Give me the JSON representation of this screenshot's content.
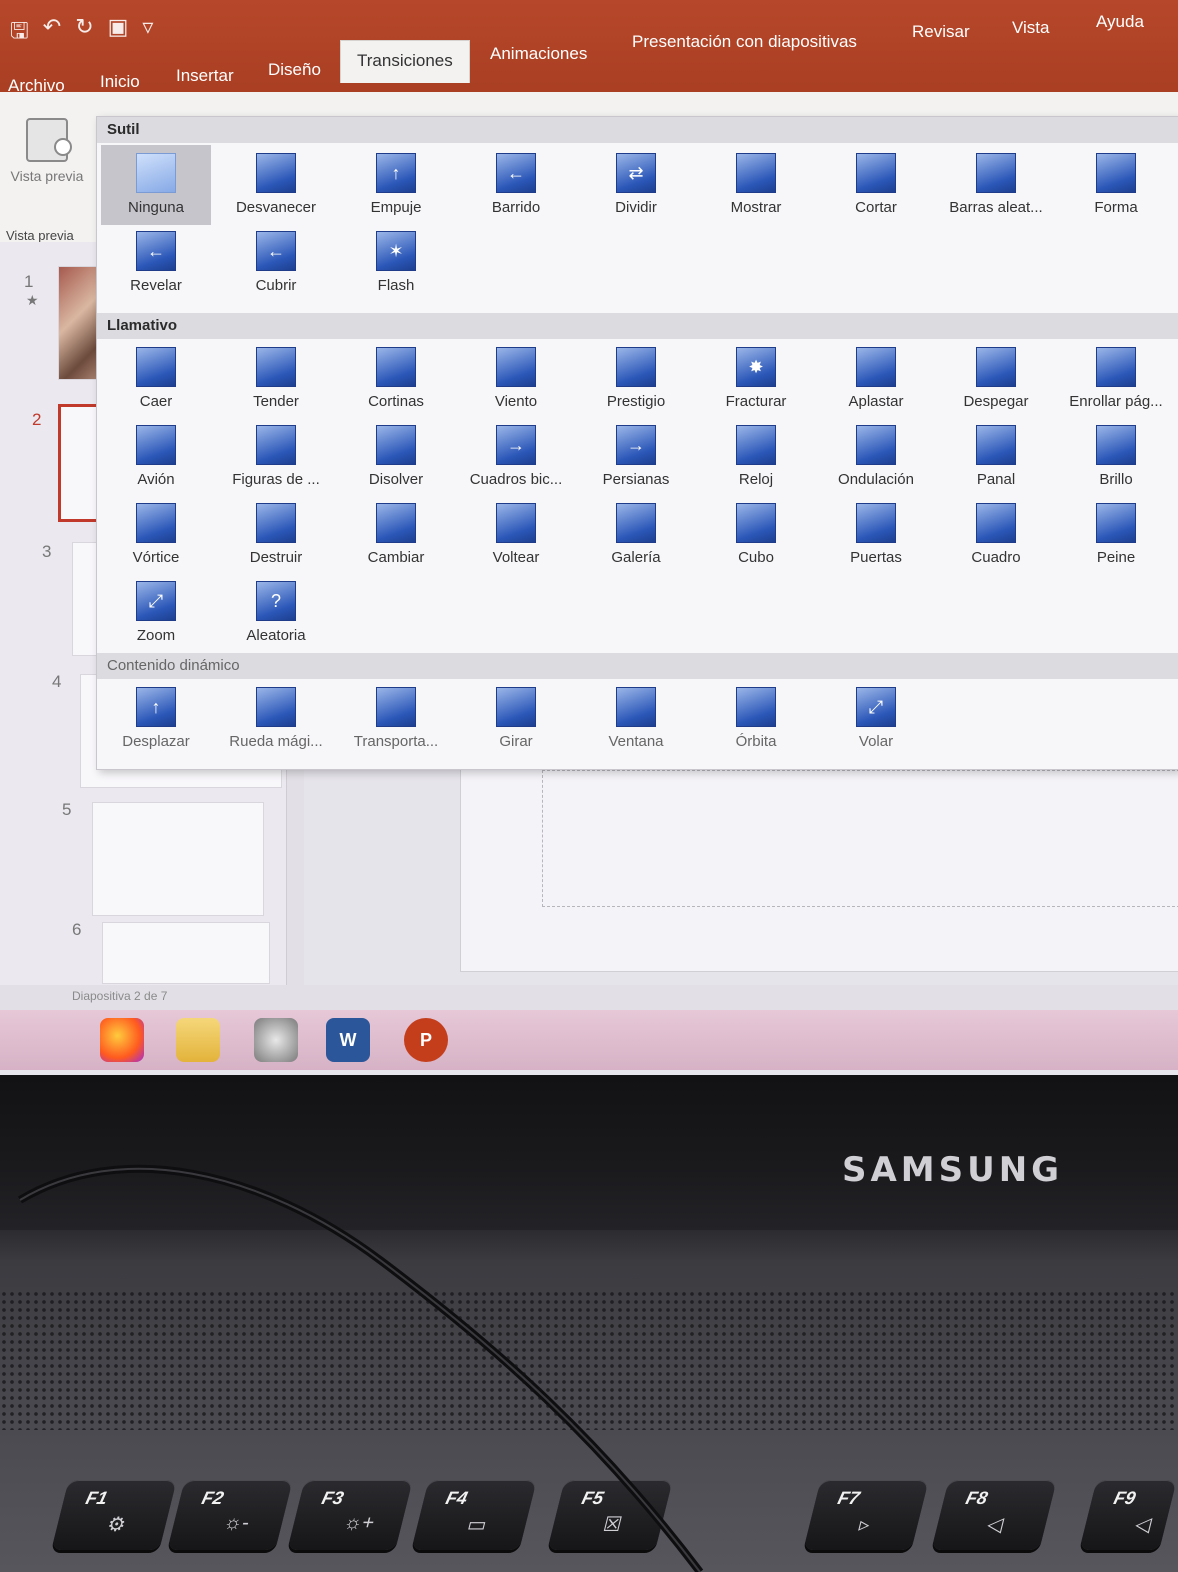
{
  "ribbon": {
    "tabs": [
      "Archivo",
      "Inicio",
      "Insertar",
      "Diseño",
      "Transiciones",
      "Animaciones",
      "Presentación con diapositivas",
      "Revisar",
      "Vista",
      "Ayuda"
    ],
    "active_tab": "Transiciones",
    "preview": {
      "button_label": "Vista previa",
      "group_label": "Vista previa"
    }
  },
  "gallery": {
    "sections": [
      {
        "title": "Sutil",
        "items": [
          "Ninguna",
          "Desvanecer",
          "Empuje",
          "Barrido",
          "Dividir",
          "Mostrar",
          "Cortar",
          "Barras aleat...",
          "Forma",
          "Revelar",
          "Cubrir",
          "Flash"
        ]
      },
      {
        "title": "Llamativo",
        "items": [
          "Caer",
          "Tender",
          "Cortinas",
          "Viento",
          "Prestigio",
          "Fracturar",
          "Aplastar",
          "Despegar",
          "Enrollar pág...",
          "Avión",
          "Figuras de ...",
          "Disolver",
          "Cuadros bic...",
          "Persianas",
          "Reloj",
          "Ondulación",
          "Panal",
          "Brillo",
          "Vórtice",
          "Destruir",
          "Cambiar",
          "Voltear",
          "Galería",
          "Cubo",
          "Puertas",
          "Cuadro",
          "Peine",
          "Zoom",
          "Aleatoria"
        ]
      },
      {
        "title": "Contenido dinámico",
        "items": [
          "Desplazar",
          "Rueda mági...",
          "Transporta...",
          "Girar",
          "Ventana",
          "Órbita",
          "Volar"
        ]
      }
    ],
    "selected": "Ninguna"
  },
  "slides": {
    "numbers": [
      "1",
      "2",
      "3",
      "4",
      "5",
      "6"
    ],
    "selected": "2"
  },
  "status": {
    "text": "Diapositiva 2 de 7"
  },
  "taskbar": {
    "apps": [
      "firefox-icon",
      "file-explorer-icon",
      "photos-icon",
      "word-icon",
      "powerpoint-icon"
    ],
    "word_letter": "W",
    "powerpoint_letter": "P"
  },
  "laptop": {
    "brand": "SAMSUNG",
    "fkeys": [
      "F1",
      "F2",
      "F3",
      "F4",
      "F5",
      "F7",
      "F8",
      "F9"
    ]
  },
  "colors": {
    "ribbon": "#b7472a",
    "icon_blue": "#2b57b8",
    "selection": "#c0392b"
  }
}
